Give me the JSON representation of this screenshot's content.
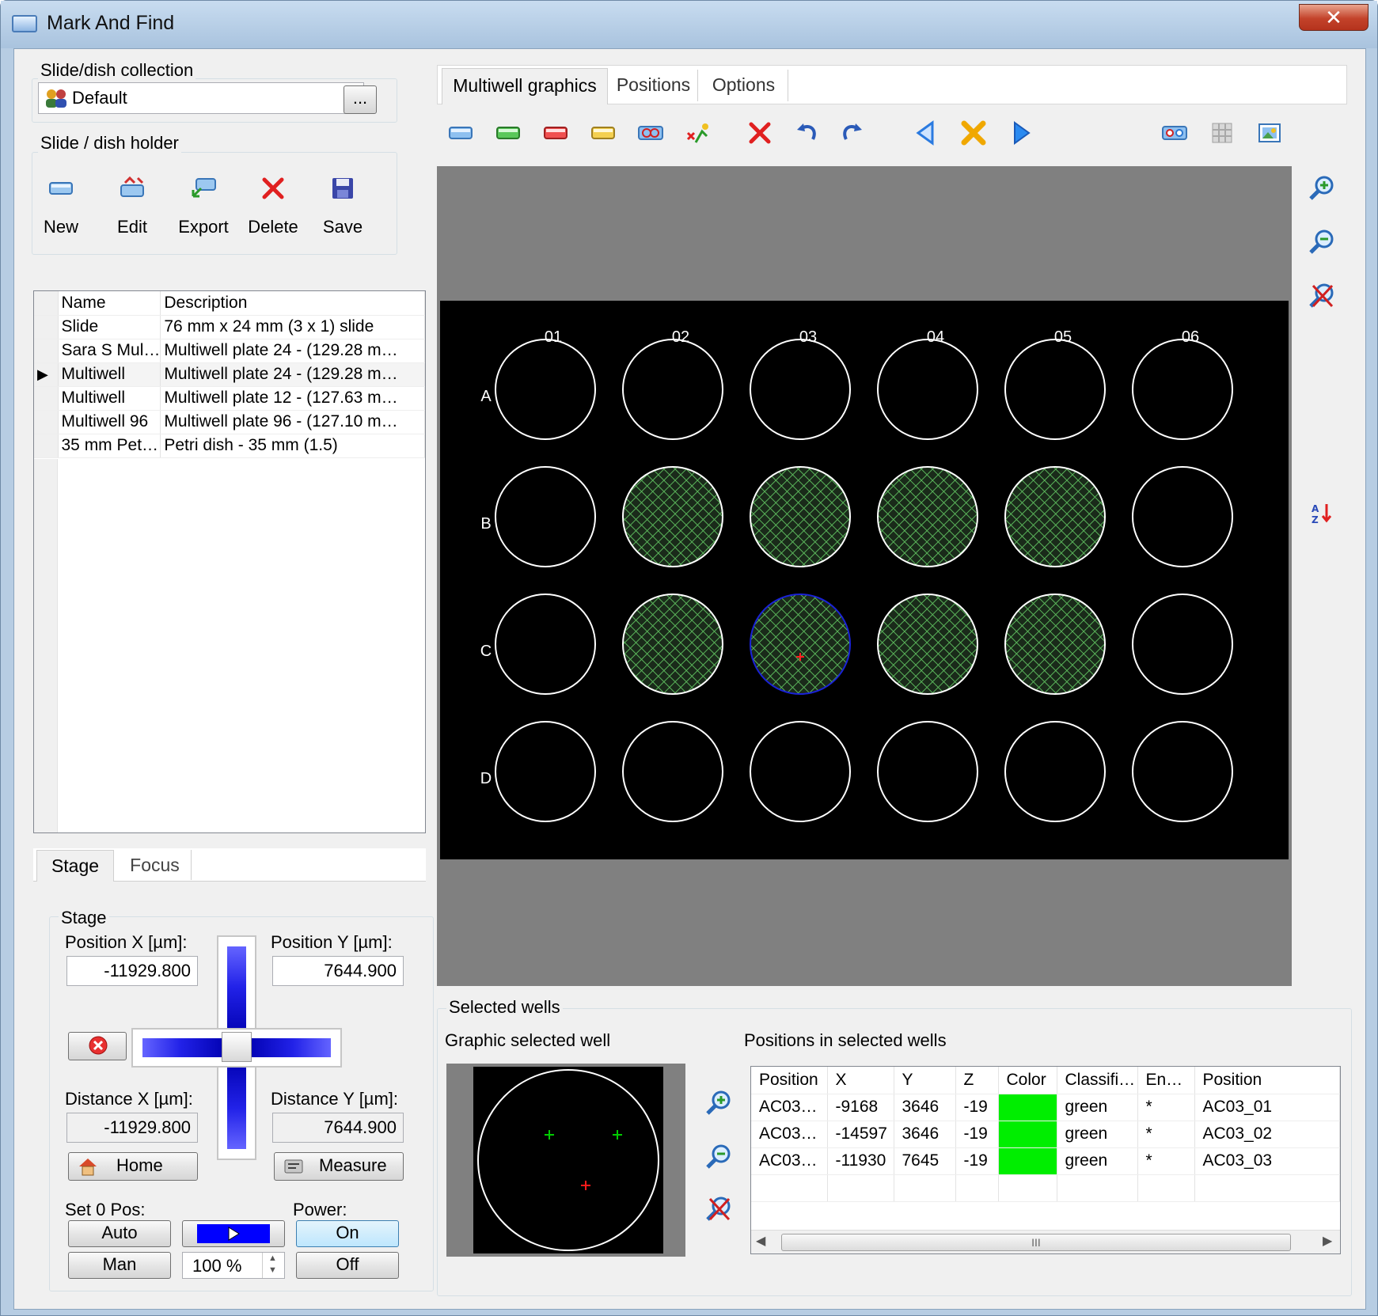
{
  "window": {
    "title": "Mark And Find",
    "close_glyph": "✕"
  },
  "collection": {
    "label": "Slide/dish collection",
    "selected": "Default",
    "browse_label": "..."
  },
  "holder": {
    "label": "Slide / dish holder",
    "buttons": [
      {
        "label": "New",
        "icon": "new-slide-icon"
      },
      {
        "label": "Edit",
        "icon": "edit-icon"
      },
      {
        "label": "Export",
        "icon": "export-icon"
      },
      {
        "label": "Delete",
        "icon": "delete-icon"
      },
      {
        "label": "Save",
        "icon": "save-icon"
      }
    ]
  },
  "slide_table": {
    "columns": [
      "Name",
      "Description"
    ],
    "rows": [
      {
        "name": "Slide",
        "description": "76 mm x 24 mm (3 x 1) slide",
        "current": false
      },
      {
        "name": "Sara S Mul…",
        "description": "Multiwell plate 24 - (129.28 m…",
        "current": false
      },
      {
        "name": "Multiwell",
        "description": "Multiwell plate 24 - (129.28 m…",
        "current": true
      },
      {
        "name": "Multiwell",
        "description": "Multiwell plate 12 - (127.63 m…",
        "current": false
      },
      {
        "name": "Multiwell 96",
        "description": "Multiwell plate 96 - (127.10 m…",
        "current": false
      },
      {
        "name": "35 mm Pet…",
        "description": "Petri dish - 35 mm (1.5)",
        "current": false
      }
    ]
  },
  "bottom_tabs": [
    {
      "label": "Stage",
      "active": true
    },
    {
      "label": "Focus",
      "active": false
    }
  ],
  "stage": {
    "group_label": "Stage",
    "pos_x_label": "Position X [µm]:",
    "pos_x": "-11929.800",
    "pos_y_label": "Position Y [µm]:",
    "pos_y": "7644.900",
    "dist_x_label": "Distance X [µm]:",
    "dist_x": "-11929.800",
    "dist_y_label": "Distance Y [µm]:",
    "dist_y": "7644.900",
    "home_label": "Home",
    "measure_label": "Measure",
    "set0_label": "Set 0 Pos:",
    "auto_label": "Auto",
    "man_label": "Man",
    "power_label": "Power:",
    "on_label": "On",
    "off_label": "Off",
    "speed": "100 %"
  },
  "main_tabs": [
    {
      "label": "Multiwell graphics",
      "active": true
    },
    {
      "label": "Positions",
      "active": false
    },
    {
      "label": "Options",
      "active": false
    }
  ],
  "toolbar": {
    "icons": [
      "slide-blue-icon",
      "slide-green-icon",
      "slide-red-icon",
      "slide-yellow-icon",
      "multi-select-icon",
      "mark-position-icon",
      "delete-positions-icon",
      "undo-icon",
      "redo-icon",
      "previous-icon",
      "clear-icon",
      "next-icon",
      "view-wells-icon",
      "grid-icon",
      "image-icon"
    ]
  },
  "plate": {
    "columns": [
      "01",
      "02",
      "03",
      "04",
      "05",
      "06"
    ],
    "rows": [
      "A",
      "B",
      "C",
      "D"
    ],
    "selected_wells": [
      "B02",
      "B03",
      "B04",
      "B05",
      "C02",
      "C03",
      "C04",
      "C05"
    ],
    "current_well": "C03",
    "well_color": "#ffffff",
    "hatch_color": "#5ab45a",
    "current_outline": "#1a22d8"
  },
  "side_icons": [
    "zoom-in-icon",
    "zoom-fit-icon",
    "zoom-reset-icon",
    "sort-icon"
  ],
  "selected_wells": {
    "group_label": "Selected wells",
    "graphic_label": "Graphic selected well",
    "positions_label": "Positions in selected wells",
    "marks": [
      {
        "color": "#00cc00",
        "kind": "position"
      },
      {
        "color": "#00cc00",
        "kind": "position"
      },
      {
        "color": "#ff1a1a",
        "kind": "current"
      }
    ],
    "table": {
      "columns": [
        "Position",
        "X",
        "Y",
        "Z",
        "Color",
        "Classifi…",
        "En…",
        "Position"
      ],
      "rows": [
        {
          "position": "AC03…",
          "x": "-9168",
          "y": "3646",
          "z": "-19",
          "color": "#00ee00",
          "classification": "green",
          "enabled": "*",
          "position2": "AC03_01"
        },
        {
          "position": "AC03…",
          "x": "-14597",
          "y": "3646",
          "z": "-19",
          "color": "#00ee00",
          "classification": "green",
          "enabled": "*",
          "position2": "AC03_02"
        },
        {
          "position": "AC03…",
          "x": "-11930",
          "y": "7645",
          "z": "-19",
          "color": "#00ee00",
          "classification": "green",
          "enabled": "*",
          "position2": "AC03_03"
        }
      ]
    },
    "scroll_grip": "III"
  }
}
